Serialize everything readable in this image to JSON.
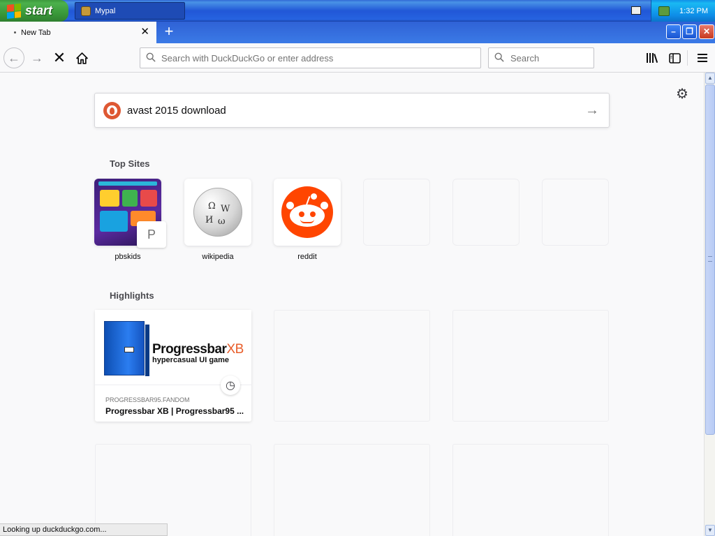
{
  "taskbar": {
    "start_label": "start",
    "window_title": "Mypal",
    "clock": "1:32 PM"
  },
  "browser": {
    "tab_title": "New Tab",
    "urlbar_placeholder": "Search with DuckDuckGo or enter address",
    "searchbar_placeholder": "Search"
  },
  "newtab": {
    "search_query": "avast 2015 download",
    "top_sites_title": "Top Sites",
    "top_sites": [
      {
        "label": "pbskids",
        "badge": "P"
      },
      {
        "label": "wikipedia"
      },
      {
        "label": "reddit"
      }
    ],
    "highlights_title": "Highlights",
    "highlight": {
      "brand": "Progressbar",
      "brand_suffix": "XB",
      "tagline": "hypercasual UI game",
      "source": "PROGRESSBAR95.FANDOM",
      "title": "Progressbar XB | Progressbar95 ..."
    }
  },
  "status": "Looking up duckduckgo.com...",
  "colors": {
    "ddg_orange": "#de5833",
    "reddit_orange": "#ff4500",
    "accent": "#0a84ff"
  }
}
